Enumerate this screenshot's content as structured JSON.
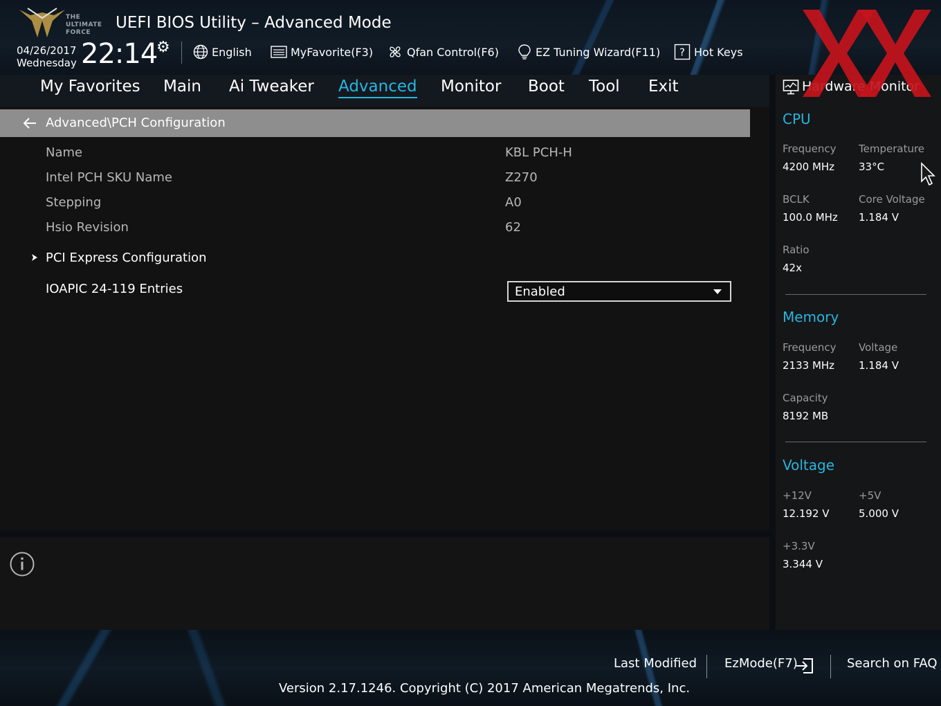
{
  "header": {
    "brand_lines": [
      "THE",
      "ULTIMATE",
      "FORCE"
    ],
    "title": "UEFI BIOS Utility – Advanced Mode",
    "date": "04/26/2017",
    "weekday": "Wednesday",
    "time": "22:14",
    "buttons": {
      "language": "English",
      "favorite": "MyFavorite(F3)",
      "qfan": "Qfan Control(F6)",
      "ez_tuning": "EZ Tuning Wizard(F11)",
      "hot_keys": "Hot Keys"
    }
  },
  "menu": {
    "items": [
      "My Favorites",
      "Main",
      "Ai Tweaker",
      "Advanced",
      "Monitor",
      "Boot",
      "Tool",
      "Exit"
    ],
    "active": "Advanced"
  },
  "main": {
    "breadcrumb": "Advanced\\PCH Configuration",
    "info_rows": [
      {
        "label": "Name",
        "value": "KBL PCH-H"
      },
      {
        "label": "Intel PCH SKU Name",
        "value": "Z270"
      },
      {
        "label": "Stepping",
        "value": "A0"
      },
      {
        "label": "Hsio Revision",
        "value": "62"
      }
    ],
    "submenu": "PCI Express Configuration",
    "ioapic": {
      "label": "IOAPIC 24-119 Entries",
      "value": "Enabled"
    }
  },
  "hwmon": {
    "title": "Hardware Monitor",
    "cpu": {
      "heading": "CPU",
      "frequency_label": "Frequency",
      "frequency": "4200 MHz",
      "temperature_label": "Temperature",
      "temperature": "33°C",
      "bclk_label": "BCLK",
      "bclk": "100.0 MHz",
      "core_voltage_label": "Core Voltage",
      "core_voltage": "1.184 V",
      "ratio_label": "Ratio",
      "ratio": "42x"
    },
    "memory": {
      "heading": "Memory",
      "frequency_label": "Frequency",
      "frequency": "2133 MHz",
      "voltage_label": "Voltage",
      "voltage": "1.184 V",
      "capacity_label": "Capacity",
      "capacity": "8192 MB"
    },
    "voltage": {
      "heading": "Voltage",
      "v12_label": "+12V",
      "v12": "12.192 V",
      "v5_label": "+5V",
      "v5": "5.000 V",
      "v33_label": "+3.3V",
      "v33": "3.344 V"
    }
  },
  "footer": {
    "last_modified": "Last Modified",
    "ezmode": "EzMode(F7)",
    "search_faq": "Search on FAQ",
    "version": "Version 2.17.1246. Copyright (C) 2017 American Megatrends, Inc."
  },
  "colors": {
    "accent": "#27b6e0",
    "watermark": "#c4141c",
    "breadcrumb_bg": "#8e8e8e"
  }
}
